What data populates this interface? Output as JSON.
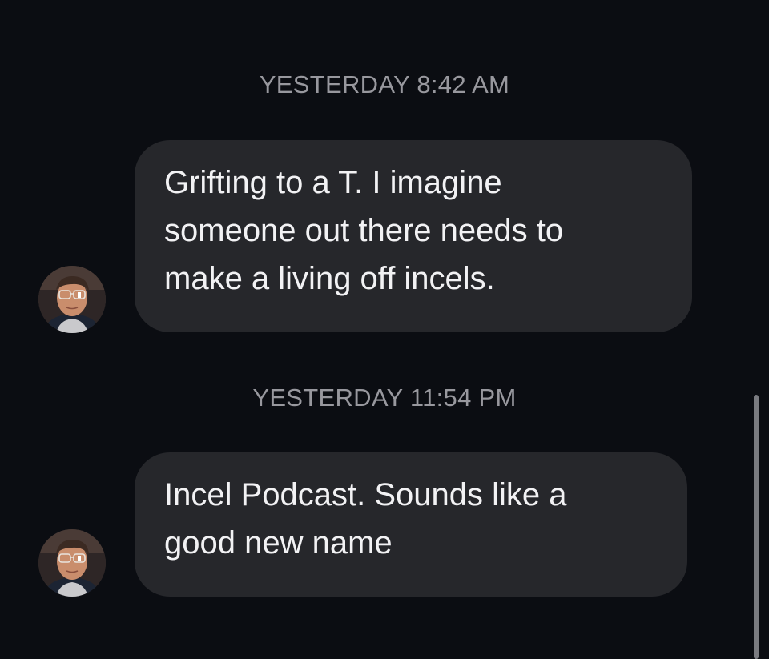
{
  "conversation": {
    "messages": [
      {
        "timestamp": "YESTERDAY 8:42 AM",
        "lines": [
          "Grifting to a T. I imagine",
          "someone out there needs to",
          "make a living off incels."
        ],
        "avatar_icon": "user-avatar-photo"
      },
      {
        "timestamp": "YESTERDAY 11:54 PM",
        "lines": [
          "Incel Podcast. Sounds like a",
          "good new name"
        ],
        "avatar_icon": "user-avatar-photo"
      }
    ]
  },
  "colors": {
    "background": "#0b0d12",
    "bubble": "#26272b",
    "message_text": "#f2f2f4",
    "timestamp_text": "#98989e",
    "scrollbar": "#7a7b80"
  }
}
